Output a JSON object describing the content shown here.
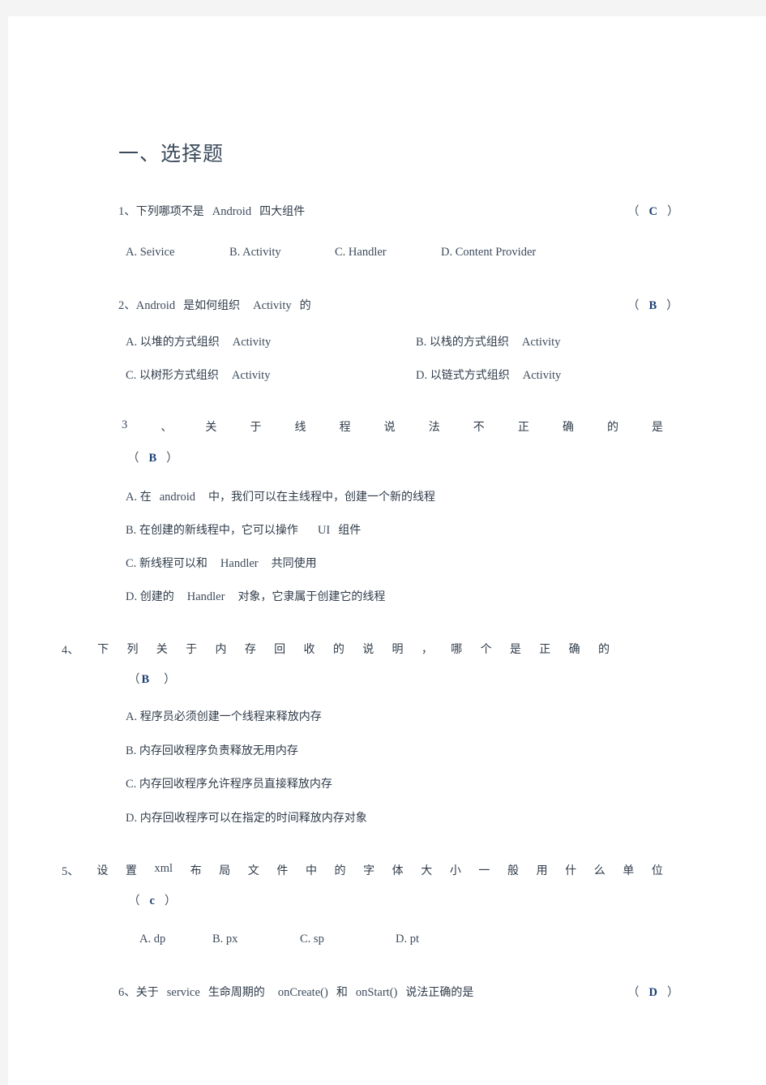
{
  "document": {
    "section_heading": "一、选择题",
    "questions": [
      {
        "number": "1、",
        "stem_cjk_1": "下列哪项不是",
        "stem_lat": "Android",
        "stem_cjk_2": "四大组件",
        "answer_open": "（",
        "answer": "C",
        "answer_close": "）",
        "options": [
          {
            "label": "A.",
            "text": "Seivice"
          },
          {
            "label": "B.",
            "text": "Activity"
          },
          {
            "label": "C.",
            "text": "Handler"
          },
          {
            "label": "D.",
            "text": "Content Provider"
          }
        ]
      },
      {
        "number": "2、",
        "stem_lat_1": "Android",
        "stem_cjk_1": "是如何组织",
        "stem_lat_2": "Activity",
        "stem_cjk_2": "的",
        "answer_open": "（",
        "answer": "B",
        "answer_close": "）",
        "options": [
          {
            "label": "A.",
            "cjk": "以堆的方式组织",
            "lat": "Activity"
          },
          {
            "label": "B.",
            "cjk": "以栈的方式组织",
            "lat": "Activity"
          },
          {
            "label": "C.",
            "cjk": "以树形方式组织",
            "lat": "Activity"
          },
          {
            "label": "D.",
            "cjk": "以链式方式组织",
            "lat": "Activity"
          }
        ]
      },
      {
        "number": "3",
        "spread_chars": [
          "、",
          "关",
          "于",
          "线",
          "程",
          "说",
          "法",
          "不",
          "正",
          "确",
          "的",
          "是"
        ],
        "answer_open": "（",
        "answer": "B",
        "answer_close": "）",
        "options": [
          {
            "label": "A.",
            "cjk_1": "在",
            "lat": "android",
            "cjk_2": "中，我们可以在主线程中，创建一个新的线程"
          },
          {
            "label": "B.",
            "cjk_1": "在创建的新线程中，它可以操作",
            "lat": "UI",
            "cjk_2": "组件"
          },
          {
            "label": "C.",
            "cjk_1": "新线程可以和",
            "lat": "Handler",
            "cjk_2": "共同使用"
          },
          {
            "label": "D.",
            "cjk_1": "创建的",
            "lat": "Handler",
            "cjk_2": "对象，它隶属于创建它的线程"
          }
        ]
      },
      {
        "number": "4、",
        "spread_chars": [
          "下",
          "列",
          "关",
          "于",
          "内",
          "存",
          "回",
          "收",
          "的",
          "说",
          "明",
          "，",
          "哪",
          "个",
          "是",
          "正",
          "确",
          "的"
        ],
        "answer_open": "（",
        "answer": "B",
        "answer_close": "）",
        "options": [
          {
            "label": "A.",
            "text": "程序员必须创建一个线程来释放内存"
          },
          {
            "label": "B.",
            "text": "内存回收程序负责释放无用内存"
          },
          {
            "label": "C.",
            "text": "内存回收程序允许程序员直接释放内存"
          },
          {
            "label": "D.",
            "text": "内存回收程序可以在指定的时间释放内存对象"
          }
        ]
      },
      {
        "number": "5、",
        "spread_chars": [
          "设",
          "置",
          "xml",
          "布",
          "局",
          "文",
          "件",
          "中",
          "的",
          "字",
          "体",
          "大",
          "小",
          "一",
          "般",
          "用",
          "什",
          "么",
          "单",
          "位"
        ],
        "answer_open": "（",
        "answer": "c",
        "answer_close": "）",
        "options": [
          {
            "label": "A.",
            "text": "dp"
          },
          {
            "label": "B.",
            "text": "px"
          },
          {
            "label": "C.",
            "text": "sp"
          },
          {
            "label": "D.",
            "text": "pt"
          }
        ]
      },
      {
        "number": "6、",
        "stem_cjk_1": "关于",
        "stem_lat_1": "service",
        "stem_cjk_2": "生命周期的",
        "stem_lat_2": "onCreate()",
        "stem_cjk_3": "和",
        "stem_lat_3": "onStart()",
        "stem_cjk_4": "说法正确的是",
        "answer_open": "（",
        "answer": "D",
        "answer_close": "）"
      }
    ]
  }
}
